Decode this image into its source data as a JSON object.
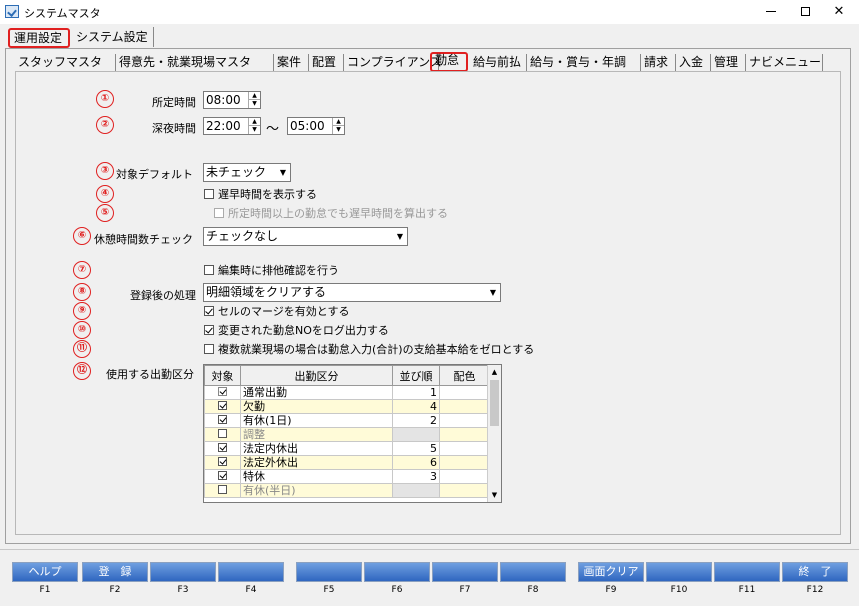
{
  "window": {
    "title": "システムマスタ"
  },
  "top_tabs": [
    "運用設定",
    "システム設定"
  ],
  "sub_tabs": [
    "スタッフマスタ",
    "得意先・就業現場マスタ",
    "案件",
    "配置",
    "コンプライアンス",
    "勤怠",
    "給与前払",
    "給与・賞与・年調",
    "請求",
    "入金",
    "管理",
    "ナビメニュー"
  ],
  "markers": [
    "①",
    "②",
    "③",
    "④",
    "⑤",
    "⑥",
    "⑦",
    "⑧",
    "⑨",
    "⑩",
    "⑪",
    "⑫"
  ],
  "form": {
    "shotei_label": "所定時間",
    "shotei_value": "08:00",
    "shinya_label": "深夜時間",
    "shinya_from": "22:00",
    "tilde": "～",
    "shinya_to": "05:00",
    "taisho_label": "対象デフォルト",
    "taisho_value": "未チェック",
    "chk_chikoku": "遅早時間を表示する",
    "chk_chikoku_sub": "所定時間以上の勤怠でも遅早時間を算出する",
    "kyukei_label": "休憩時間数チェック",
    "kyukei_value": "チェックなし",
    "chk_haita": "編集時に排他確認を行う",
    "toroku_label": "登録後の処理",
    "toroku_value": "明細領域をクリアする",
    "chk_merge": "セルのマージを有効とする",
    "chk_log": "変更された勤怠NOをログ出力する",
    "chk_fukusu": "複数就業現場の場合は勤怠入力(合計)の支給基本給をゼロとする",
    "shukkin_label": "使用する出勤区分"
  },
  "grid": {
    "headers": [
      "対象",
      "出勤区分",
      "並び順",
      "配色"
    ],
    "rows": [
      {
        "checked": true,
        "disabled": true,
        "name": "通常出勤",
        "order": "1",
        "alt": false,
        "gray": false,
        "dim": false
      },
      {
        "checked": true,
        "disabled": false,
        "name": "欠勤",
        "order": "4",
        "alt": true,
        "gray": false,
        "dim": false
      },
      {
        "checked": true,
        "disabled": false,
        "name": "有休(1日)",
        "order": "2",
        "alt": false,
        "gray": false,
        "dim": false
      },
      {
        "checked": false,
        "disabled": false,
        "name": "調整",
        "order": "",
        "alt": true,
        "gray": true,
        "dim": true
      },
      {
        "checked": true,
        "disabled": false,
        "name": "法定内休出",
        "order": "5",
        "alt": false,
        "gray": false,
        "dim": false
      },
      {
        "checked": true,
        "disabled": false,
        "name": "法定外休出",
        "order": "6",
        "alt": true,
        "gray": false,
        "dim": false
      },
      {
        "checked": true,
        "disabled": false,
        "name": "特休",
        "order": "3",
        "alt": false,
        "gray": false,
        "dim": false
      },
      {
        "checked": false,
        "disabled": false,
        "name": "有休(半日)",
        "order": "",
        "alt": true,
        "gray": true,
        "dim": true
      }
    ]
  },
  "fkeys": [
    {
      "label": "ヘルプ",
      "key": "F1"
    },
    {
      "label": "登　録",
      "key": "F2"
    },
    {
      "label": "",
      "key": "F3"
    },
    {
      "label": "",
      "key": "F4"
    },
    {
      "label": "",
      "key": "F5"
    },
    {
      "label": "",
      "key": "F6"
    },
    {
      "label": "",
      "key": "F7"
    },
    {
      "label": "",
      "key": "F8"
    },
    {
      "label": "画面クリア",
      "key": "F9"
    },
    {
      "label": "",
      "key": "F10"
    },
    {
      "label": "",
      "key": "F11"
    },
    {
      "label": "終　了",
      "key": "F12"
    }
  ],
  "colors": {
    "highlight": "#e02020",
    "fkey": "#3f74cc",
    "alt_row": "#fffbd8"
  }
}
